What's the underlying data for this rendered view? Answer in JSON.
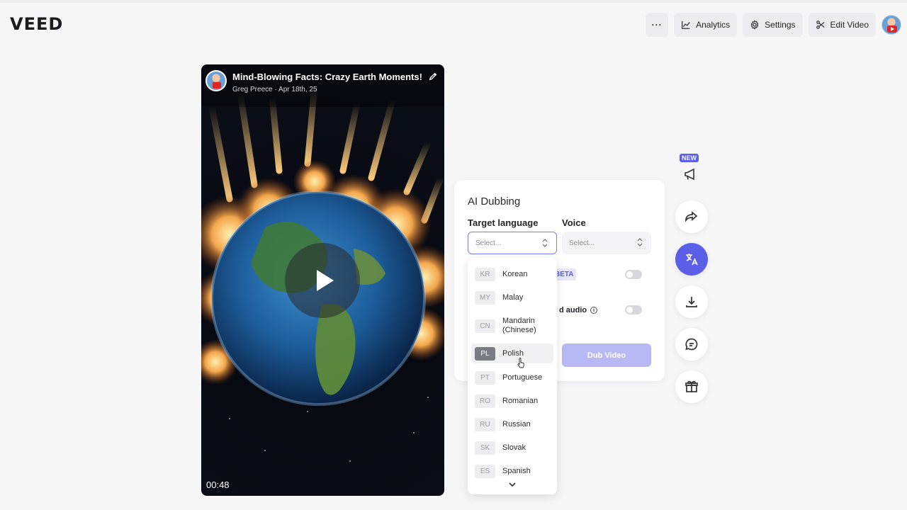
{
  "app": {
    "logo": "VEED"
  },
  "toolbar": {
    "more_label": "···",
    "analytics_label": "Analytics",
    "settings_label": "Settings",
    "edit_label": "Edit Video"
  },
  "video": {
    "title": "Mind-Blowing Facts: Crazy Earth Moments!",
    "author": "Greg Preece",
    "date": "Apr 18th, 25",
    "duration": "00:48"
  },
  "dubbing": {
    "title": "AI Dubbing",
    "target_language_label": "Target language",
    "voice_label": "Voice",
    "target_placeholder": "Select...",
    "voice_placeholder": "Select...",
    "beta_badge": "BETA",
    "audio_label": "d audio",
    "info_glyph": "i",
    "dub_button": "Dub Video"
  },
  "languages": [
    {
      "code": "KR",
      "name": "Korean"
    },
    {
      "code": "MY",
      "name": "Malay"
    },
    {
      "code": "CN",
      "name": "Mandarin (Chinese)"
    },
    {
      "code": "PL",
      "name": "Polish"
    },
    {
      "code": "PT",
      "name": "Portuguese"
    },
    {
      "code": "RO",
      "name": "Romanian"
    },
    {
      "code": "RU",
      "name": "Russian"
    },
    {
      "code": "SK",
      "name": "Slovak"
    },
    {
      "code": "ES",
      "name": "Spanish"
    }
  ],
  "hovered_language": "Polish",
  "rail": {
    "new_badge": "NEW",
    "items": [
      "announcement-icon",
      "share-icon",
      "translate-icon",
      "download-icon",
      "comment-icon",
      "gift-icon"
    ],
    "active_item": "translate-icon"
  },
  "colors": {
    "accent": "#5b5ee6",
    "dub_button_disabled": "#b8b9f4"
  }
}
